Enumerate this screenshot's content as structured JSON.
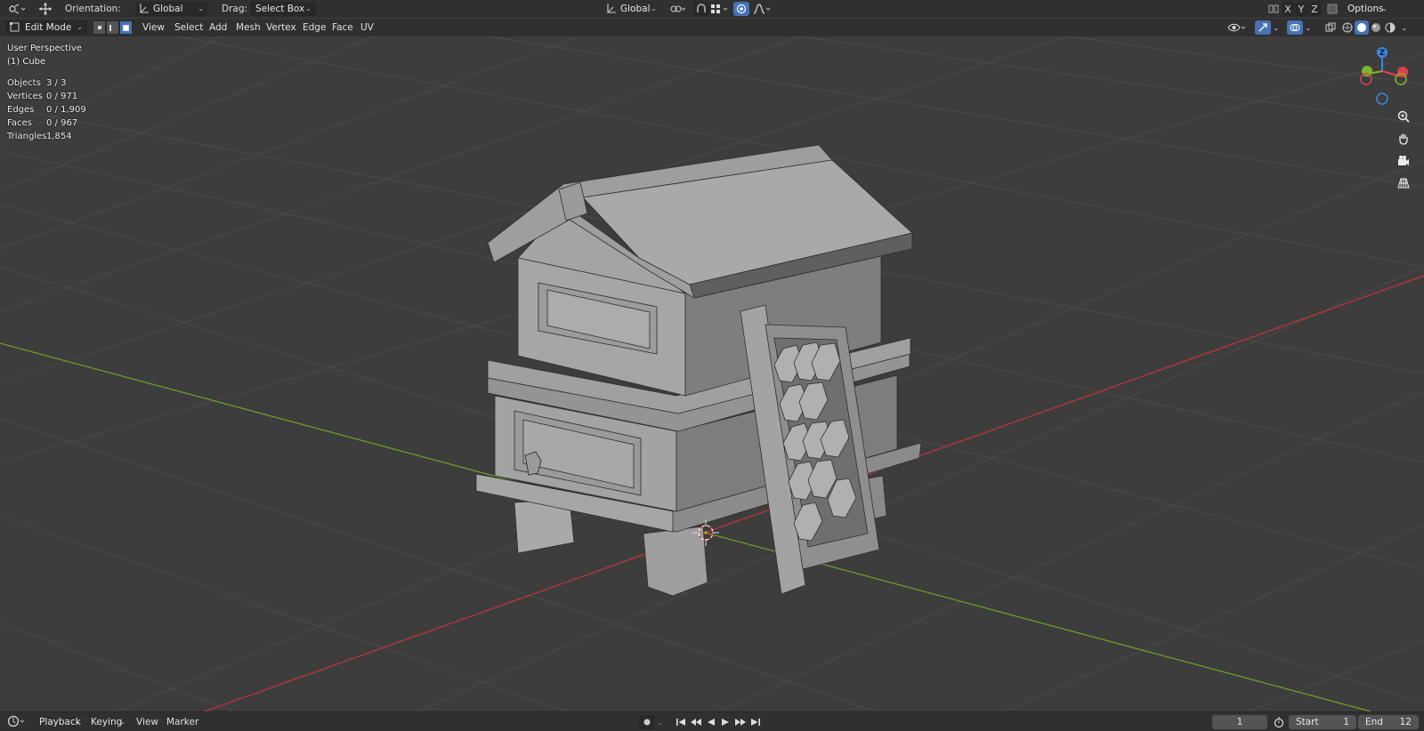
{
  "tool_header": {
    "orientation_label": "Orientation:",
    "orientation_value": "Global",
    "drag_label": "Drag:",
    "drag_value": "Select Box",
    "transform_orientation_value": "Global",
    "axis_x": "X",
    "axis_y": "Y",
    "axis_z": "Z",
    "options_label": "Options"
  },
  "view_header": {
    "mode_value": "Edit Mode",
    "menus": [
      "View",
      "Select",
      "Add",
      "Mesh",
      "Vertex",
      "Edge",
      "Face",
      "UV"
    ]
  },
  "viewport_info": {
    "perspective": "User Perspective",
    "object_name": "(1) Cube",
    "stats": [
      {
        "label": "Objects",
        "value": "3 / 3"
      },
      {
        "label": "Vertices",
        "value": "0 / 971"
      },
      {
        "label": "Edges",
        "value": "0 / 1,909"
      },
      {
        "label": "Faces",
        "value": "0 / 967"
      },
      {
        "label": "Triangles",
        "value": "1,854"
      }
    ]
  },
  "gizmo": {
    "z_label": "Z",
    "colors": {
      "x": "#e0414d",
      "y": "#7bb72a",
      "z": "#3d87e0"
    }
  },
  "timeline": {
    "playback_label": "Playback",
    "keying_label": "Keying",
    "view_label": "View",
    "marker_label": "Marker",
    "current_frame": "1",
    "start_label": "Start",
    "start_value": "1",
    "end_label": "End",
    "end_value": "12"
  },
  "colors": {
    "background": "#3d3d3d",
    "header": "#303030",
    "accent": "#4772b3",
    "x_axis_line": "#b9343e",
    "y_axis_line": "#6d9a26"
  }
}
